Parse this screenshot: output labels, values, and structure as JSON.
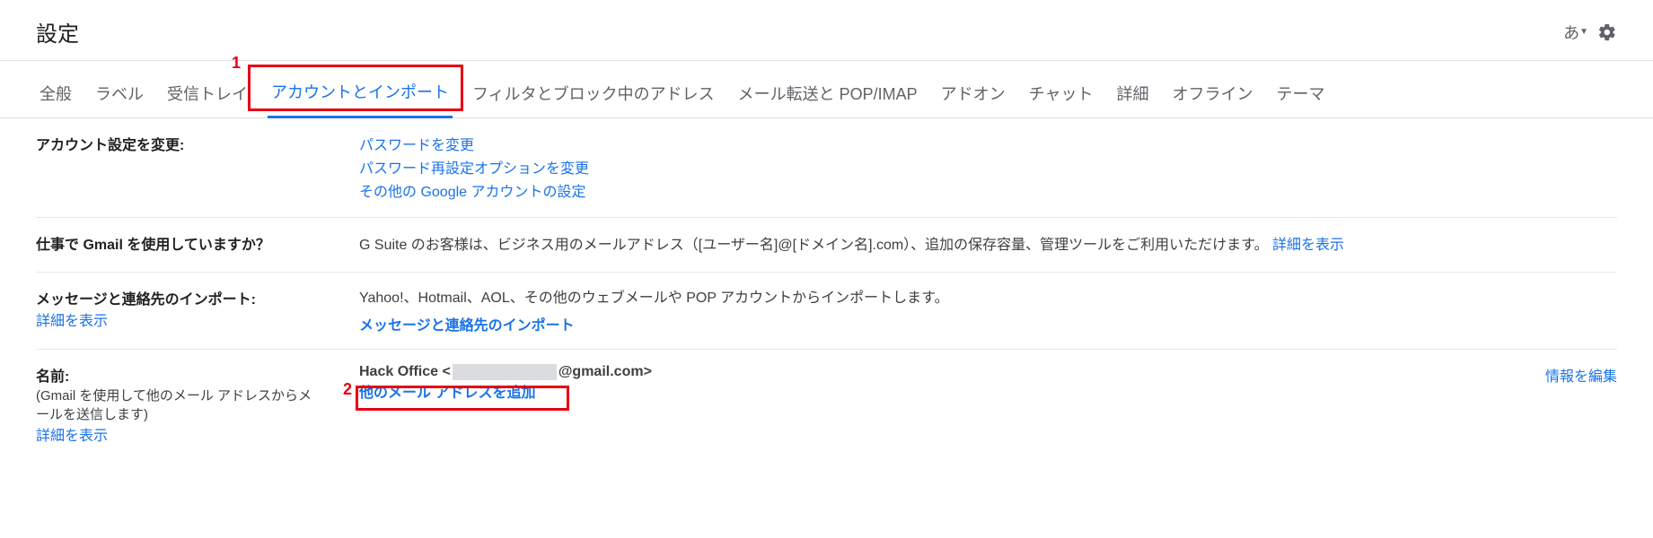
{
  "header": {
    "title": "設定",
    "ime": "あ"
  },
  "tabs": [
    "全般",
    "ラベル",
    "受信トレイ",
    "アカウントとインポート",
    "フィルタとブロック中のアドレス",
    "メール転送と POP/IMAP",
    "アドオン",
    "チャット",
    "詳細",
    "オフライン",
    "テーマ"
  ],
  "activeTabIndex": 3,
  "annotations": {
    "num1": "1",
    "num2": "2"
  },
  "sections": {
    "account_change": {
      "label": "アカウント設定を変更:",
      "links": [
        "パスワードを変更",
        "パスワード再設定オプションを変更",
        "その他の Google アカウントの設定"
      ]
    },
    "gsuite": {
      "label": "仕事で Gmail を使用していますか？",
      "text": "G Suite のお客様は、ビジネス用のメールアドレス（[ユーザー名]@[ドメイン名].com）、追加の保存容量、管理ツールをご利用いただけます。",
      "details_link": "詳細を表示"
    },
    "import": {
      "label": "メッセージと連絡先のインポート:",
      "sub_link": "詳細を表示",
      "text": "Yahoo!、Hotmail、AOL、その他のウェブメールや POP アカウントからインポートします。",
      "action_link": "メッセージと連絡先のインポート"
    },
    "name": {
      "label": "名前:",
      "sub": "(Gmail を使用して他のメール アドレスからメールを送信します)",
      "sub_link": "詳細を表示",
      "sender_prefix": "Hack Office <",
      "sender_suffix": "@gmail.com>",
      "add_link": "他のメール アドレスを追加",
      "edit_link": "情報を編集"
    }
  }
}
